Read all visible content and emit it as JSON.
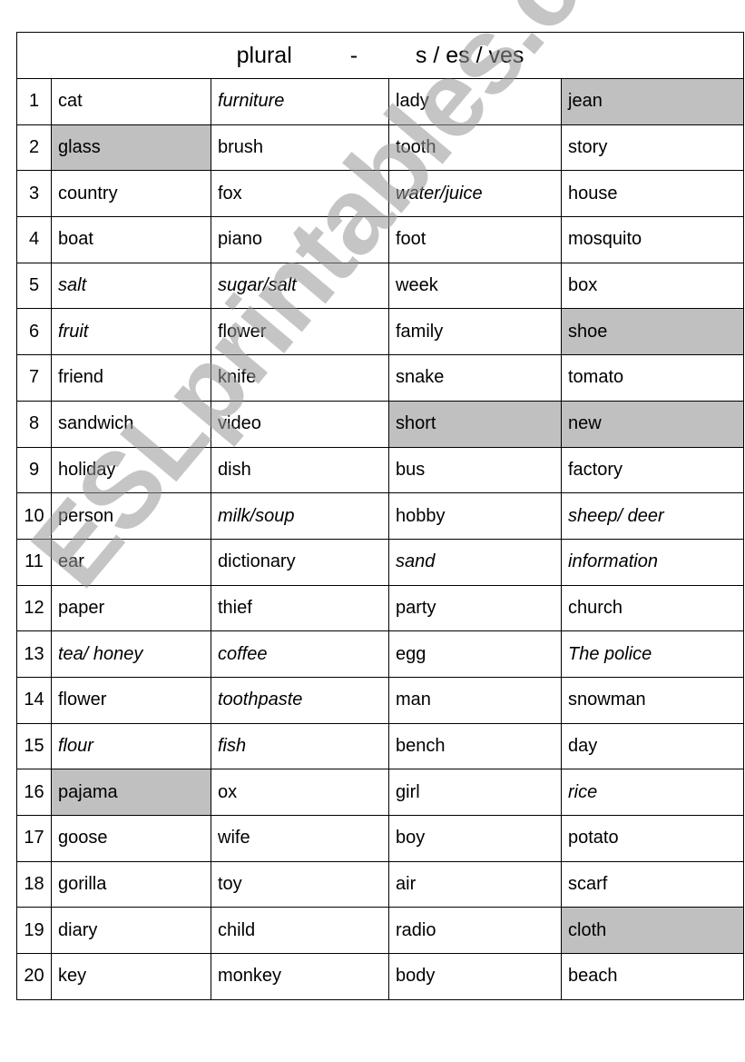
{
  "title": {
    "left": "plural",
    "dash": "-",
    "right": "s / es / ves"
  },
  "watermark": "ESLprintables.com",
  "colors": {
    "shade": "#c0c0c0"
  },
  "rows": [
    {
      "n": "1",
      "cells": [
        {
          "t": "cat"
        },
        {
          "t": "furniture",
          "i": 1
        },
        {
          "t": "lady"
        },
        {
          "t": "jean",
          "s": 1
        }
      ]
    },
    {
      "n": "2",
      "cells": [
        {
          "t": "glass",
          "s": 1
        },
        {
          "t": "brush"
        },
        {
          "t": "tooth"
        },
        {
          "t": "story"
        }
      ]
    },
    {
      "n": "3",
      "cells": [
        {
          "t": "country"
        },
        {
          "t": "fox"
        },
        {
          "t": "water/juice",
          "i": 1
        },
        {
          "t": "house"
        }
      ]
    },
    {
      "n": "4",
      "cells": [
        {
          "t": "boat"
        },
        {
          "t": "piano"
        },
        {
          "t": "foot"
        },
        {
          "t": "mosquito"
        }
      ]
    },
    {
      "n": "5",
      "cells": [
        {
          "t": "salt",
          "i": 1
        },
        {
          "t": "sugar/salt",
          "i": 1
        },
        {
          "t": "week"
        },
        {
          "t": "box"
        }
      ]
    },
    {
      "n": "6",
      "cells": [
        {
          "t": "fruit",
          "i": 1
        },
        {
          "t": "flower"
        },
        {
          "t": "family"
        },
        {
          "t": "shoe",
          "s": 1
        }
      ]
    },
    {
      "n": "7",
      "cells": [
        {
          "t": "friend"
        },
        {
          "t": "knife"
        },
        {
          "t": "snake"
        },
        {
          "t": "tomato"
        }
      ]
    },
    {
      "n": "8",
      "cells": [
        {
          "t": "sandwich"
        },
        {
          "t": "video"
        },
        {
          "t": "short",
          "s": 1
        },
        {
          "t": "new",
          "s": 1
        }
      ]
    },
    {
      "n": "9",
      "cells": [
        {
          "t": "holiday"
        },
        {
          "t": "dish"
        },
        {
          "t": "bus"
        },
        {
          "t": "factory"
        }
      ]
    },
    {
      "n": "10",
      "cells": [
        {
          "t": "person"
        },
        {
          "t": "milk/soup",
          "i": 1
        },
        {
          "t": "hobby"
        },
        {
          "t": "sheep/ deer",
          "i": 1
        }
      ]
    },
    {
      "n": "11",
      "cells": [
        {
          "t": "ear"
        },
        {
          "t": "dictionary"
        },
        {
          "t": "sand",
          "i": 1
        },
        {
          "t": "information",
          "i": 1
        }
      ]
    },
    {
      "n": "12",
      "cells": [
        {
          "t": "paper"
        },
        {
          "t": "thief"
        },
        {
          "t": "party"
        },
        {
          "t": "church"
        }
      ]
    },
    {
      "n": "13",
      "cells": [
        {
          "t": "tea/ honey",
          "i": 1
        },
        {
          "t": "coffee",
          "i": 1
        },
        {
          "t": "egg"
        },
        {
          "t": "The police",
          "i": 1
        }
      ]
    },
    {
      "n": "14",
      "cells": [
        {
          "t": "flower"
        },
        {
          "t": "toothpaste",
          "i": 1
        },
        {
          "t": "man"
        },
        {
          "t": "snowman"
        }
      ]
    },
    {
      "n": "15",
      "cells": [
        {
          "t": "flour",
          "i": 1
        },
        {
          "t": "fish",
          "i": 1
        },
        {
          "t": "bench"
        },
        {
          "t": "day"
        }
      ]
    },
    {
      "n": "16",
      "cells": [
        {
          "t": "pajama",
          "s": 1
        },
        {
          "t": "ox"
        },
        {
          "t": "girl"
        },
        {
          "t": "rice",
          "i": 1
        }
      ]
    },
    {
      "n": "17",
      "cells": [
        {
          "t": "goose"
        },
        {
          "t": "wife"
        },
        {
          "t": "boy"
        },
        {
          "t": "potato"
        }
      ]
    },
    {
      "n": "18",
      "cells": [
        {
          "t": "gorilla"
        },
        {
          "t": "toy"
        },
        {
          "t": "air"
        },
        {
          "t": "scarf"
        }
      ]
    },
    {
      "n": "19",
      "cells": [
        {
          "t": "diary"
        },
        {
          "t": "child"
        },
        {
          "t": "radio"
        },
        {
          "t": "cloth",
          "s": 1
        }
      ]
    },
    {
      "n": "20",
      "cells": [
        {
          "t": "key"
        },
        {
          "t": "monkey"
        },
        {
          "t": "body"
        },
        {
          "t": "beach"
        }
      ]
    }
  ]
}
